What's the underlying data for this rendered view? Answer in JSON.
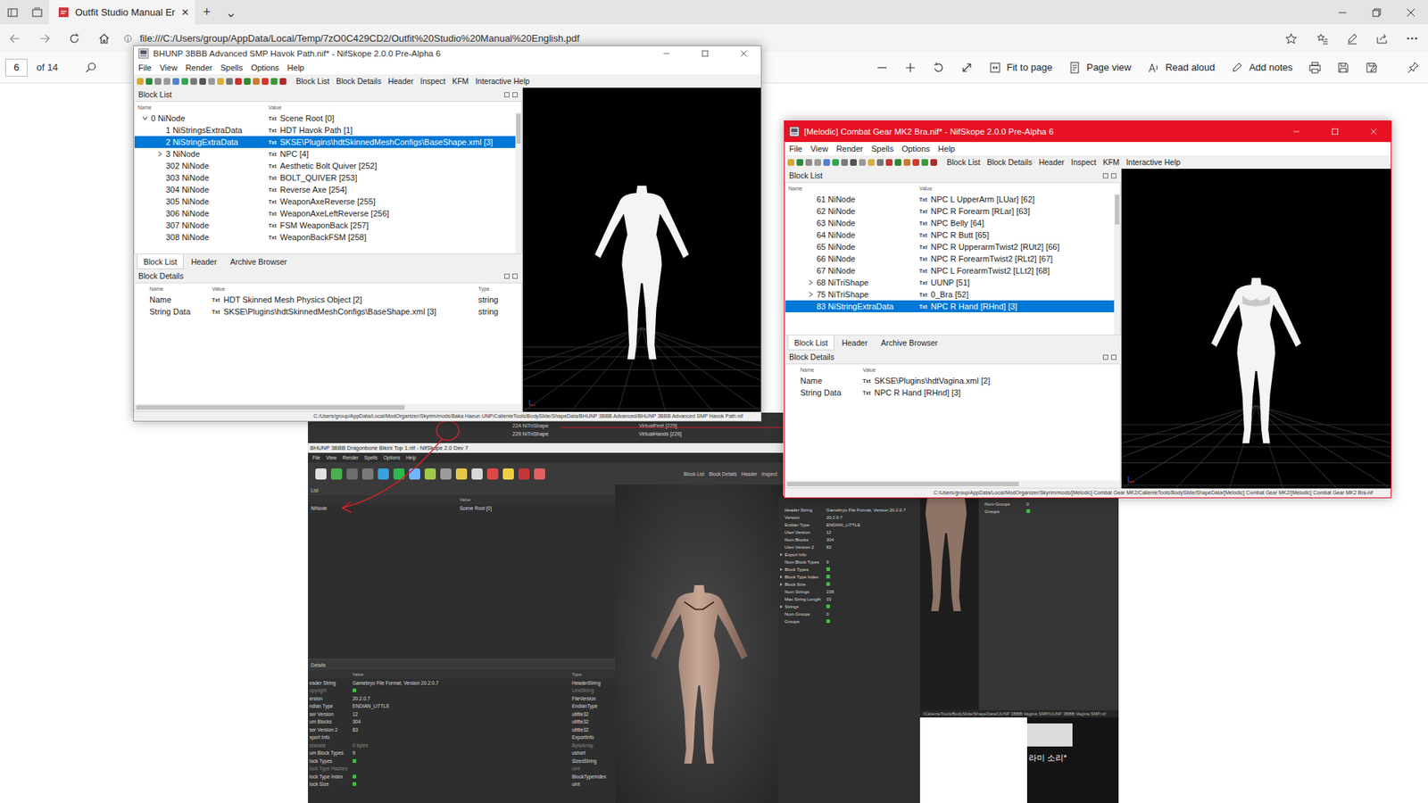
{
  "browser": {
    "tab": {
      "title": "Outfit Studio Manual Er",
      "close": "×"
    },
    "new_tab": "+",
    "tab_list": "⌄",
    "url": "file:///C:/Users/group/AppData/Local/Temp/7zO0C429CD2/Outfit%20Studio%20Manual%20English.pdf",
    "more": "···"
  },
  "pdf_toolbar": {
    "page": "6",
    "page_count": "of 14",
    "buttons": [
      "Fit to page",
      "Page view",
      "Read aloud",
      "Add notes"
    ]
  },
  "nif_windows": [
    {
      "title": "BHUNP 3BBB Advanced SMP Havok Path.nif* - NifSkope 2.0.0 Pre-Alpha 6",
      "active": false,
      "menu": [
        "File",
        "View",
        "Render",
        "Spells",
        "Options",
        "Help"
      ],
      "toolbar_tabs": [
        "Block List",
        "Block Details",
        "Header",
        "Inspect",
        "KFM",
        "Interactive Help"
      ],
      "list_title": "Block List",
      "list_columns": [
        "Name",
        "Value"
      ],
      "badge": "Txt",
      "rows": [
        {
          "num": "0",
          "type": "NiNode",
          "value": "Scene Root [0]",
          "depth": 0,
          "expander": "expanded",
          "selected": false
        },
        {
          "num": "1",
          "type": "NiStringsExtraData",
          "value": "HDT Havok Path [1]",
          "depth": 1,
          "expander": "none",
          "selected": false
        },
        {
          "num": "2",
          "type": "NiStringExtraData",
          "value": "SKSE\\Plugins\\hdtSkinnedMeshConfigs\\BaseShape.xml [3]",
          "depth": 1,
          "expander": "none",
          "selected": true
        },
        {
          "num": "3",
          "type": "NiNode",
          "value": "NPC [4]",
          "depth": 1,
          "expander": "collapsed",
          "selected": false
        },
        {
          "num": "302",
          "type": "NiNode",
          "value": "Aesthetic Bolt Quiver [252]",
          "depth": 1,
          "expander": "none",
          "selected": false
        },
        {
          "num": "303",
          "type": "NiNode",
          "value": "BOLT_QUIVER [253]",
          "depth": 1,
          "expander": "none",
          "selected": false
        },
        {
          "num": "304",
          "type": "NiNode",
          "value": "Reverse Axe [254]",
          "depth": 1,
          "expander": "none",
          "selected": false
        },
        {
          "num": "305",
          "type": "NiNode",
          "value": "WeaponAxeReverse [255]",
          "depth": 1,
          "expander": "none",
          "selected": false
        },
        {
          "num": "306",
          "type": "NiNode",
          "value": "WeaponAxeLeftReverse [256]",
          "depth": 1,
          "expander": "none",
          "selected": false
        },
        {
          "num": "307",
          "type": "NiNode",
          "value": "FSM WeaponBack [257]",
          "depth": 1,
          "expander": "none",
          "selected": false
        },
        {
          "num": "308",
          "type": "NiNode",
          "value": "WeaponBackFSM [258]",
          "depth": 1,
          "expander": "none",
          "selected": false
        }
      ],
      "tabs": [
        {
          "label": "Block List",
          "selected": true
        },
        {
          "label": "Header",
          "selected": false
        },
        {
          "label": "Archive Browser",
          "selected": false
        }
      ],
      "details_title": "Block Details",
      "details_columns": [
        "Name",
        "Value",
        "Type"
      ],
      "details": [
        {
          "name": "Name",
          "value": "HDT Skinned Mesh Physics Object [2]",
          "type": "string"
        },
        {
          "name": "String Data",
          "value": "SKSE\\Plugins\\hdtSkinnedMeshConfigs\\BaseShape.xml [3]",
          "type": "string"
        }
      ],
      "status": "C:/Users/group/AppData/Local/ModOrganizer/Skyrim/mods/Baka Haeun UNP/CalienteTools/BodySlide/ShapeData/BHUNP 3BBB Advanced/BHUNP 3BBB Advanced SMP Havok Path.nif"
    },
    {
      "title": "[Melodic] Combat Gear MK2 Bra.nif* - NifSkope 2.0.0 Pre-Alpha 6",
      "active": true,
      "menu": [
        "File",
        "View",
        "Render",
        "Spells",
        "Options",
        "Help"
      ],
      "toolbar_tabs": [
        "Block List",
        "Block Details",
        "Header",
        "Inspect",
        "KFM",
        "Interactive Help"
      ],
      "list_title": "Block List",
      "list_columns": [
        "Name",
        "Value"
      ],
      "badge": "Txt",
      "rows": [
        {
          "num": "61",
          "type": "NiNode",
          "value": "NPC L UpperArm [LUar] [62]",
          "depth": 1,
          "expander": "none",
          "selected": false
        },
        {
          "num": "62",
          "type": "NiNode",
          "value": "NPC R Forearm [RLar] [63]",
          "depth": 1,
          "expander": "none",
          "selected": false
        },
        {
          "num": "63",
          "type": "NiNode",
          "value": "NPC Belly [64]",
          "depth": 1,
          "expander": "none",
          "selected": false
        },
        {
          "num": "64",
          "type": "NiNode",
          "value": "NPC R Butt [65]",
          "depth": 1,
          "expander": "none",
          "selected": false
        },
        {
          "num": "65",
          "type": "NiNode",
          "value": "NPC R UpperarmTwist2 [RUt2] [66]",
          "depth": 1,
          "expander": "none",
          "selected": false
        },
        {
          "num": "66",
          "type": "NiNode",
          "value": "NPC R ForearmTwist2 [RLt2] [67]",
          "depth": 1,
          "expander": "none",
          "selected": false
        },
        {
          "num": "67",
          "type": "NiNode",
          "value": "NPC L ForearmTwist2 [LLt2] [68]",
          "depth": 1,
          "expander": "none",
          "selected": false
        },
        {
          "num": "68",
          "type": "NiTriShape",
          "value": "UUNP [51]",
          "depth": 1,
          "expander": "collapsed",
          "selected": false
        },
        {
          "num": "75",
          "type": "NiTriShape",
          "value": "0_Bra [52]",
          "depth": 1,
          "expander": "collapsed",
          "selected": false
        },
        {
          "num": "83",
          "type": "NiStringExtraData",
          "value": "NPC R Hand [RHnd] [3]",
          "depth": 1,
          "expander": "none",
          "selected": true
        }
      ],
      "tabs": [
        {
          "label": "Block List",
          "selected": true
        },
        {
          "label": "Header",
          "selected": false
        },
        {
          "label": "Archive Browser",
          "selected": false
        }
      ],
      "details_title": "Block Details",
      "details_columns": [
        "Name",
        "Value"
      ],
      "details": [
        {
          "name": "Name",
          "value": "SKSE\\Plugins\\hdtVagina.xml [2]"
        },
        {
          "name": "String Data",
          "value": "NPC R Hand [RHnd] [3]"
        }
      ],
      "status": "C:/Users/group/AppData/Local/ModOrganizer/Skyrim/mods/[Melodic] Combat Gear MK2/CalienteTools/BodySlide/ShapeData/[Melodic] Combat Gear MK2/[Melodic] Combat Gear MK2 Bra.nif"
    }
  ],
  "pdf_image": {
    "tree_strip": [
      {
        "num": "224",
        "type": "NiTriShape",
        "value": "VirtualFeet [225]"
      },
      {
        "num": "229",
        "type": "NiTriShape",
        "value": "VirtualHands [226]"
      }
    ],
    "window": {
      "title": "BHUNP 3BBB Dragonbone Bikini Top 1.nif - NifSkope 2.0 Dev 7",
      "menu": [
        "File",
        "View",
        "Render",
        "Spells",
        "Options",
        "Help"
      ],
      "toolbar_tabs": [
        "Block List",
        "Block Details",
        "Header",
        "Inspect"
      ],
      "list_title": "List",
      "list_columns": [
        "Value"
      ],
      "list_rows": [
        {
          "name": "NiNode",
          "value": "Scene Root [0]"
        }
      ],
      "details_title": "Details",
      "details_columns": [
        "Value",
        "Type"
      ],
      "details": [
        {
          "name": "eader String",
          "value": "Gamebryo File Format, Version 20.2.0.7",
          "type": "HeaderString",
          "icon": false,
          "greyed": false
        },
        {
          "name": "opyright",
          "value": "",
          "type": "LineString",
          "icon": true,
          "greyed": true
        },
        {
          "name": "ersion",
          "value": "20.2.0.7",
          "type": "FileVersion",
          "icon": false,
          "greyed": false
        },
        {
          "name": "ndian Type",
          "value": "ENDIAN_LITTLE",
          "type": "EndianType",
          "icon": false,
          "greyed": false
        },
        {
          "name": "ser Version",
          "value": "12",
          "type": "ulittle32",
          "icon": false,
          "greyed": false
        },
        {
          "name": "um Blocks",
          "value": "304",
          "type": "ulittle32",
          "icon": false,
          "greyed": false
        },
        {
          "name": "ser Version 2",
          "value": "83",
          "type": "ulittle32",
          "icon": false,
          "greyed": false
        },
        {
          "name": "xport Info",
          "value": "",
          "type": "ExportInfo",
          "icon": false,
          "greyed": false
        },
        {
          "name": "etadata",
          "value": "0 bytes",
          "type": "ByteArray",
          "icon": false,
          "greyed": true
        },
        {
          "name": "um Block Types",
          "value": "9",
          "type": "ushort",
          "icon": false,
          "greyed": false
        },
        {
          "name": "lock Types",
          "value": "",
          "type": "SizedString",
          "icon": true,
          "greyed": false
        },
        {
          "name": "lock Type Hashes",
          "value": "",
          "type": "uint",
          "icon": false,
          "greyed": true
        },
        {
          "name": "lock Type Index",
          "value": "",
          "type": "BlockTypeIndex",
          "icon": true,
          "greyed": false
        },
        {
          "name": "lock Size",
          "value": "",
          "type": "uint",
          "icon": true,
          "greyed": false
        }
      ]
    },
    "header_panel": [
      {
        "name": "Header String",
        "value": "Gamebryo File Format, Version 20.2.0.7",
        "expandable": false,
        "icon": false
      },
      {
        "name": "Version",
        "value": "20.2.0.7",
        "expandable": false,
        "icon": false
      },
      {
        "name": "Endian Type",
        "value": "ENDIAN_LITTLE",
        "expandable": false,
        "icon": false
      },
      {
        "name": "User Version",
        "value": "12",
        "expandable": false,
        "icon": false
      },
      {
        "name": "Num Blocks",
        "value": "304",
        "expandable": false,
        "icon": false
      },
      {
        "name": "User Version 2",
        "value": "83",
        "expandable": false,
        "icon": false
      },
      {
        "name": "Export Info",
        "value": "",
        "expandable": true,
        "icon": false
      },
      {
        "name": "Num Block Types",
        "value": "9",
        "expandable": false,
        "icon": false
      },
      {
        "name": "Block Types",
        "value": "",
        "expandable": true,
        "icon": true
      },
      {
        "name": "Block Type Index",
        "value": "",
        "expandable": true,
        "icon": true
      },
      {
        "name": "Block Size",
        "value": "",
        "expandable": true,
        "icon": true
      },
      {
        "name": "Num Strings",
        "value": "238",
        "expandable": false,
        "icon": false
      },
      {
        "name": "Max String Length",
        "value": "33",
        "expandable": false,
        "icon": false
      },
      {
        "name": "Strings",
        "value": "",
        "expandable": true,
        "icon": true
      },
      {
        "name": "Num Groups",
        "value": "0",
        "expandable": false,
        "icon": false
      },
      {
        "name": "Groups",
        "value": "",
        "expandable": false,
        "icon": true
      }
    ],
    "groups_panel": [
      {
        "name": "Num Groups",
        "value": "0",
        "icon": false
      },
      {
        "name": "Groups",
        "value": "",
        "icon": true
      }
    ],
    "status": "/CalienteTools/BodySlide/ShapeData/UUNP 3BBB Vagina SMP/UUNP 3BBB Vagina SMP.nif",
    "caption": "라미 소리*"
  }
}
